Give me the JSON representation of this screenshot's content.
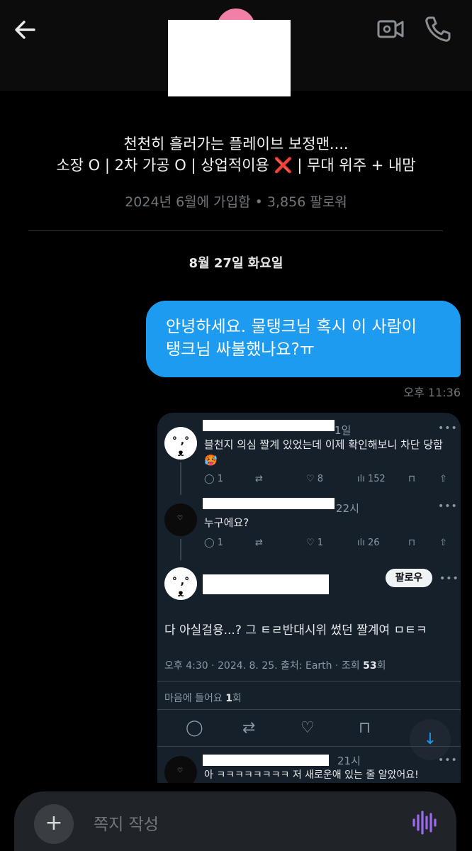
{
  "header": {
    "back_icon": "arrow-left-icon",
    "video_icon": "video-camera-icon",
    "phone_icon": "phone-icon"
  },
  "profile": {
    "bio_line1": "천천히 흘러가는 플레이브 보정맨....",
    "bio_line2": "소장 O | 2차 가공 O | 상업적이용 ❌ | 무대 위주 + 내맘",
    "joined": "2024년 6월에 가입함 • 3,856 팔로워"
  },
  "conversation": {
    "date": "8월 27일 화요일",
    "messages": [
      {
        "line1": "안녕하세요. 물탱크님 혹시 이 사람이",
        "line2": "탱크님 싸불했나요?ㅠ",
        "time": "오후 11:36"
      }
    ]
  },
  "attached_screenshot": {
    "tweets": [
      {
        "time": "1일",
        "text_line1": "블천지 의심 짤계 있었는데 이제 확인해보니 차단 당함",
        "text_line2": "🥵",
        "replies": "1",
        "likes": "8",
        "views": "152"
      },
      {
        "time": "22시",
        "text_line1": "누구에요?",
        "replies": "1",
        "likes": "1",
        "views": "26"
      }
    ],
    "focused_tweet": {
      "follow_label": "팔로우",
      "text": "다 아실걸용...? 그 ㅌㄹ반대시위 썼던 짤계여 ㅁㅌㅋ",
      "meta_prefix": "오후 4:30 · 2024. 8. 25. 출처: Earth · 조회 ",
      "meta_views": "53",
      "meta_suffix": "회",
      "likes_prefix": "마음에 들어요 ",
      "likes_count": "1",
      "likes_suffix": "회"
    },
    "last_reply": {
      "time": "21시",
      "text": "아 ㅋㅋㅋㅋㅋㅋㅋㅋ 저 새로운애 있는 줄 알았어요!"
    }
  },
  "composer": {
    "placeholder": "쪽지 작성",
    "plus_icon": "plus-icon",
    "voice_icon": "voice-wave-icon"
  },
  "colors": {
    "accent": "#1d9bf0",
    "voice": "#9a6bf0"
  }
}
